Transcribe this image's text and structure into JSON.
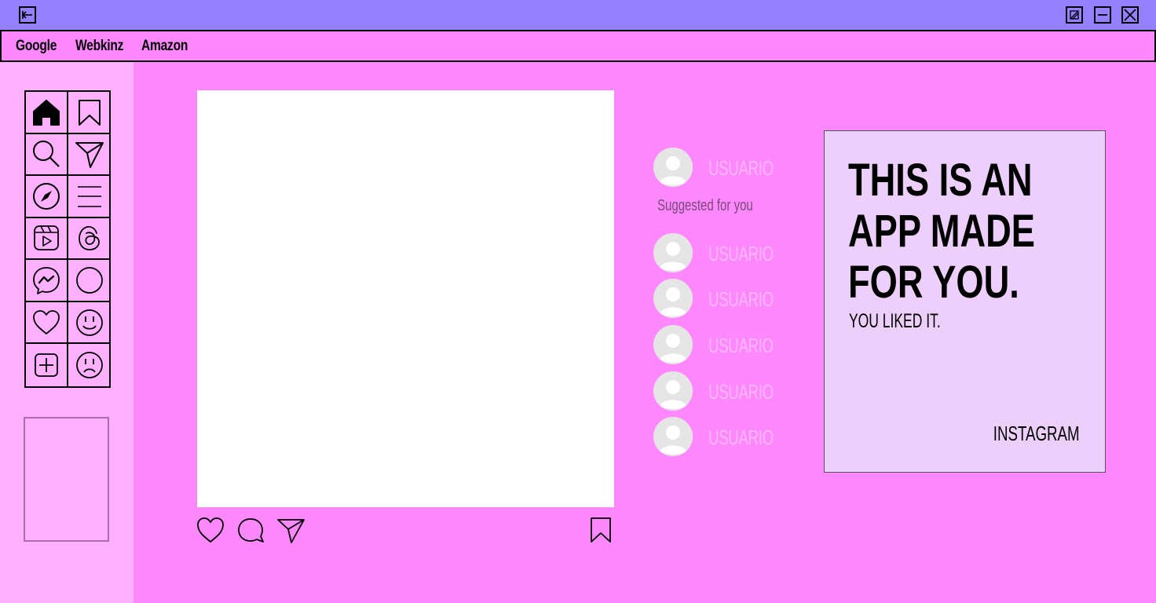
{
  "window": {
    "back_icon": "arrow-left-icon",
    "controls": [
      "restore-icon",
      "minimize-icon",
      "close-icon"
    ]
  },
  "bookmarks": [
    {
      "label": "Google"
    },
    {
      "label": "Webkinz"
    },
    {
      "label": "Amazon"
    }
  ],
  "nav_icons": [
    "home-icon",
    "bookmark-icon",
    "search-icon",
    "send-icon",
    "compass-icon",
    "menu-icon",
    "reels-icon",
    "threads-icon",
    "messenger-icon",
    "circle-icon",
    "heart-icon",
    "smile-icon",
    "add-icon",
    "sad-icon"
  ],
  "post": {
    "actions": [
      "like-icon",
      "comment-icon",
      "share-icon"
    ],
    "save_icon": "bookmark-icon"
  },
  "profile": {
    "username": "USUARIO"
  },
  "suggestions": {
    "title": "Suggested  for you",
    "users": [
      {
        "username": "USUARIO"
      },
      {
        "username": "USUARIO"
      },
      {
        "username": "USUARIO"
      },
      {
        "username": "USUARIO"
      },
      {
        "username": "USUARIO"
      }
    ]
  },
  "promo": {
    "line1": "THIS IS AN",
    "line2": "APP MADE",
    "line3": "FOR YOU.",
    "subtitle": "YOU LIKED IT.",
    "brand": "INSTAGRAM"
  },
  "colors": {
    "titlebar": "#9580ff",
    "background": "#ff88ff",
    "sidebar": "#ffb1ff",
    "card": "#eccffa",
    "username": "#ffb6ff"
  }
}
